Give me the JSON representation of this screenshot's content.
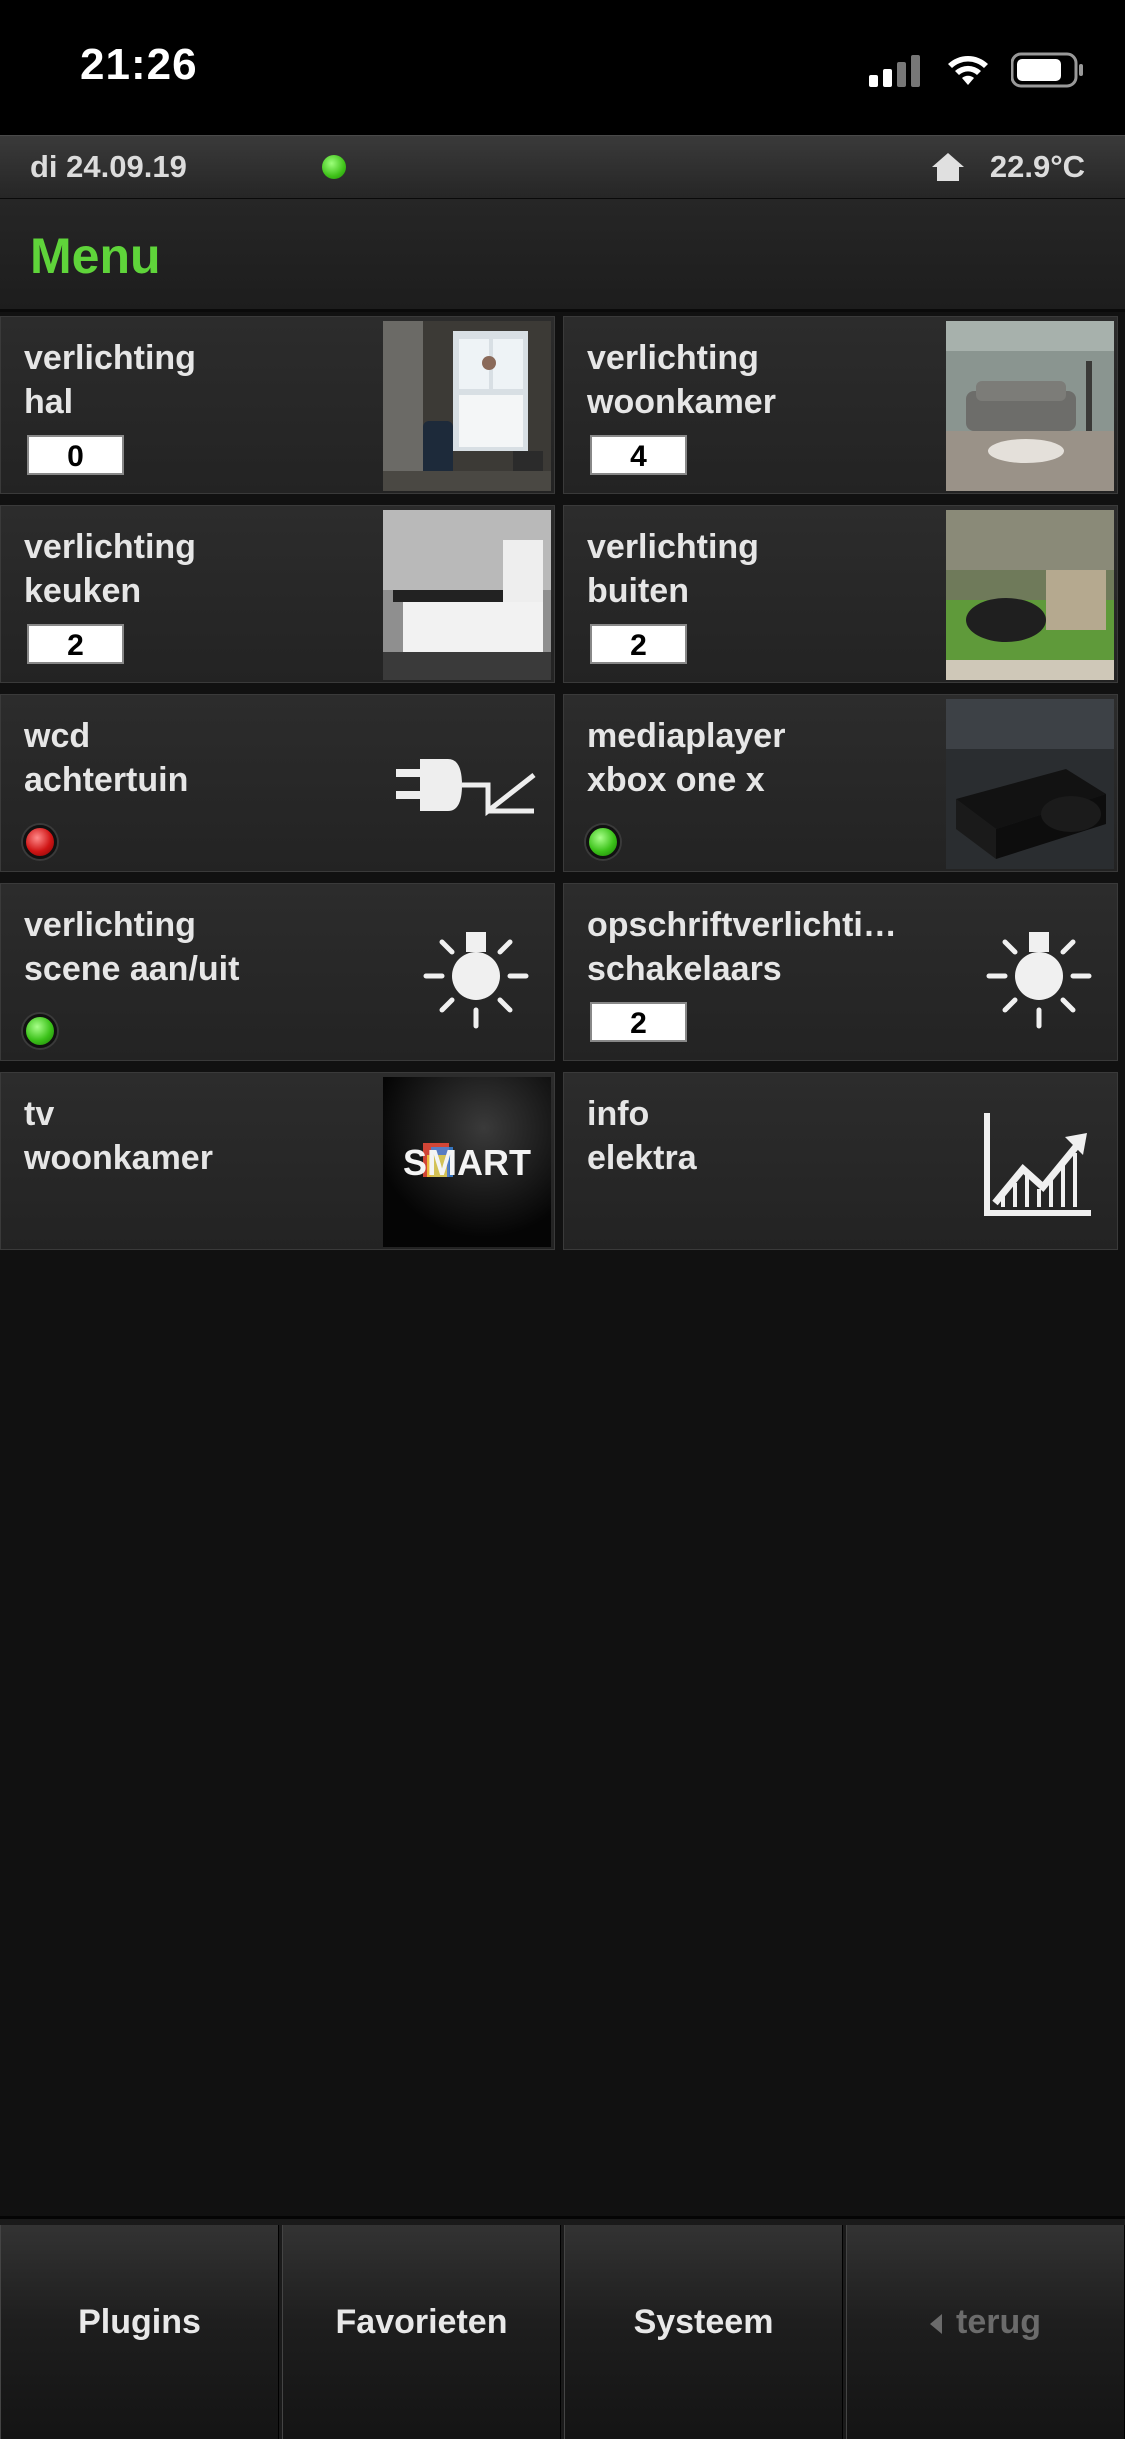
{
  "status_bar": {
    "time": "21:26"
  },
  "info_bar": {
    "date": "di 24.09.19",
    "temperature": "22.9°C"
  },
  "header": {
    "title": "Menu"
  },
  "tiles": [
    {
      "line1": "verlichting",
      "line2": "hal",
      "value": "0",
      "visual": "photo-hallway"
    },
    {
      "line1": "verlichting",
      "line2": "woonkamer",
      "value": "4",
      "visual": "photo-livingroom"
    },
    {
      "line1": "verlichting",
      "line2": "keuken",
      "value": "2",
      "visual": "photo-kitchen"
    },
    {
      "line1": "verlichting",
      "line2": "buiten",
      "value": "2",
      "visual": "photo-garden"
    },
    {
      "line1": "wcd",
      "line2": "achtertuin",
      "status": "red",
      "visual": "plug-icon"
    },
    {
      "line1": "mediaplayer",
      "line2": "xbox one x",
      "status": "green",
      "visual": "photo-xbox"
    },
    {
      "line1": "verlichting",
      "line2": "scene aan/uit",
      "status": "green",
      "visual": "bulb-icon"
    },
    {
      "line1": "opschriftverlichti…",
      "line2": "schakelaars",
      "value": "2",
      "visual": "bulb-icon"
    },
    {
      "line1": "tv",
      "line2": "woonkamer",
      "visual": "smart-tv-logo",
      "logo_text": "SMART"
    },
    {
      "line1": "info",
      "line2": "elektra",
      "visual": "chart-up-icon"
    }
  ],
  "tabbar": {
    "tabs": [
      {
        "label": "Plugins"
      },
      {
        "label": "Favorieten"
      },
      {
        "label": "Systeem"
      },
      {
        "label": "terug"
      }
    ]
  },
  "colors": {
    "accent": "#5fd43a",
    "background": "#111111",
    "led_red": "#d01515",
    "led_green": "#3cc21a"
  }
}
